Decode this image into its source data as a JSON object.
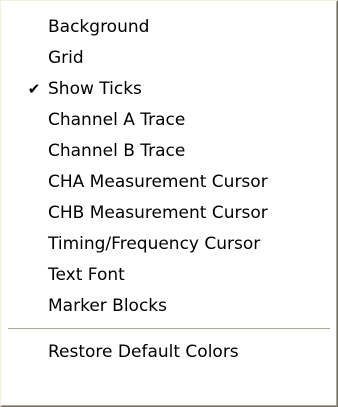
{
  "menu": {
    "items": [
      {
        "label": "Background",
        "checked": false
      },
      {
        "label": "Grid",
        "checked": false
      },
      {
        "label": "Show Ticks",
        "checked": true
      },
      {
        "label": "Channel A Trace",
        "checked": false
      },
      {
        "label": "Channel B Trace",
        "checked": false
      },
      {
        "label": "CHA Measurement Cursor",
        "checked": false
      },
      {
        "label": "CHB Measurement Cursor",
        "checked": false
      },
      {
        "label": "Timing/Frequency Cursor",
        "checked": false
      },
      {
        "label": "Text Font",
        "checked": false
      },
      {
        "label": "Marker Blocks",
        "checked": false
      }
    ],
    "footer_item": {
      "label": "Restore Default Colors"
    },
    "check_glyph": "✔"
  },
  "colors": {
    "background": "#ffffff",
    "text": "#000000",
    "border_dark": "#716f64",
    "separator": "#aca899"
  }
}
